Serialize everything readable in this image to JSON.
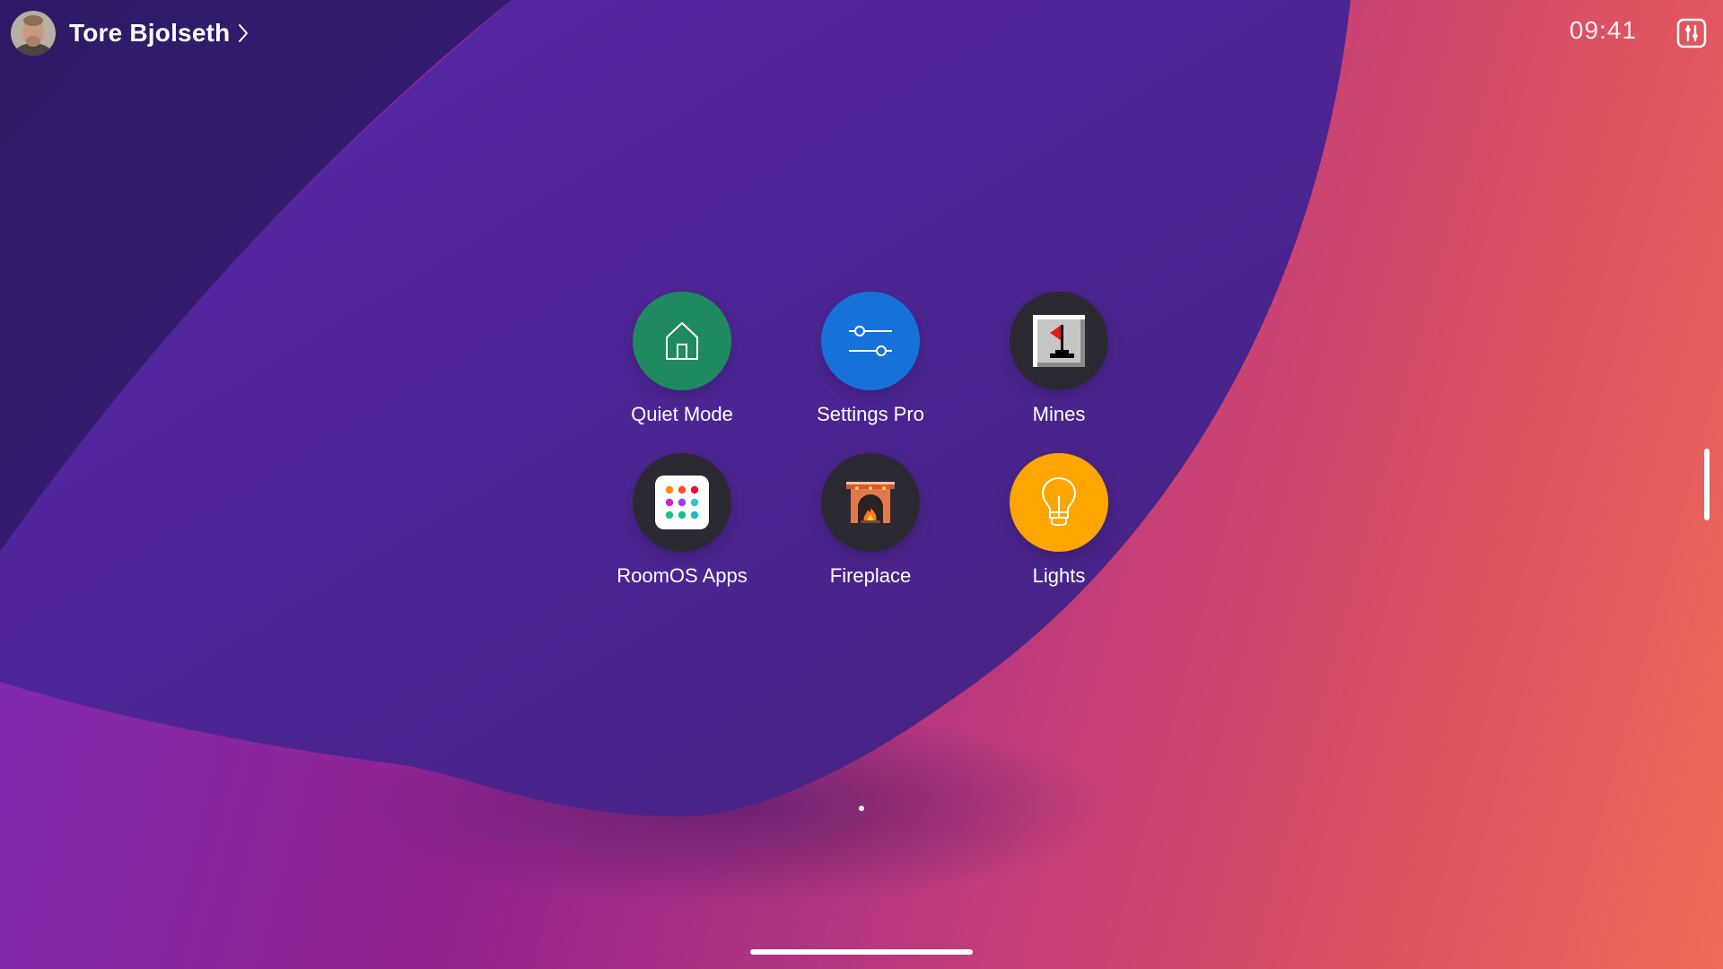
{
  "user": {
    "name": "Tore Bjolseth"
  },
  "status_bar": {
    "time": "09:41"
  },
  "apps": [
    {
      "label": "Quiet Mode",
      "icon": "house-icon",
      "color": "#1f8a5f"
    },
    {
      "label": "Settings Pro",
      "icon": "sliders-icon",
      "color": "#1672d8"
    },
    {
      "label": "Mines",
      "icon": "minesweeper-flag-icon",
      "color": "#2b2a33"
    },
    {
      "label": "RoomOS Apps",
      "icon": "dots-grid-icon",
      "color": "#2b2a33"
    },
    {
      "label": "Fireplace",
      "icon": "fireplace-icon",
      "color": "#2b2a33"
    },
    {
      "label": "Lights",
      "icon": "lightbulb-icon",
      "color": "#ffa500"
    }
  ],
  "pagination": {
    "current_page": 1,
    "total_pages": 1
  }
}
